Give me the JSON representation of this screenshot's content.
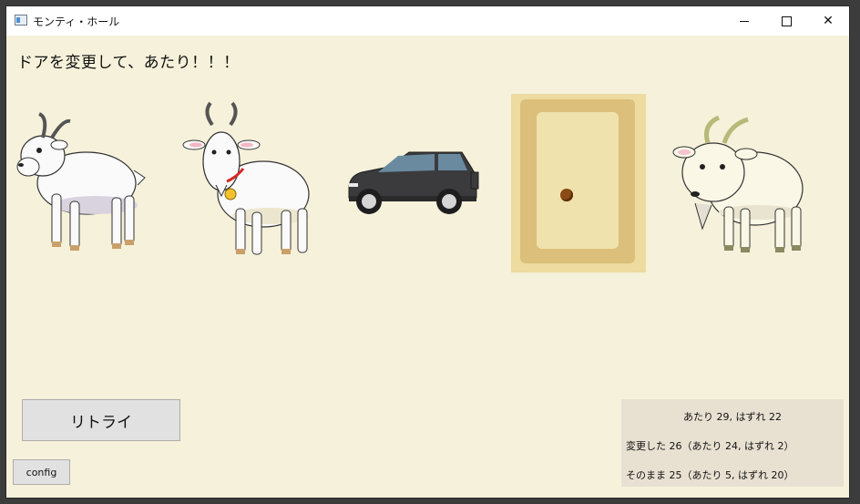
{
  "window": {
    "title": "モンティ・ホール",
    "icon": "app-window-icon"
  },
  "controls": {
    "minimize": "minimize-icon",
    "maximize": "maximize-icon",
    "close_glyph": "✕"
  },
  "message": "ドアを変更して、あたり！！！",
  "doors": [
    {
      "content": "goat"
    },
    {
      "content": "goat"
    },
    {
      "content": "car"
    },
    {
      "content": "closed-door"
    },
    {
      "content": "goat"
    }
  ],
  "buttons": {
    "retry": "リトライ",
    "config": "config"
  },
  "stats": {
    "total": "あたり 29, はずれ 22",
    "changed": "変更した 26（あたり 24, はずれ 2）",
    "stayed": "そのまま 25（あたり 5, はずれ 20）"
  },
  "colors": {
    "background": "#f6f1da",
    "door": "#dbbf7a",
    "door_highlight": "#eddba0",
    "stats_panel": "#e8e1d2"
  }
}
